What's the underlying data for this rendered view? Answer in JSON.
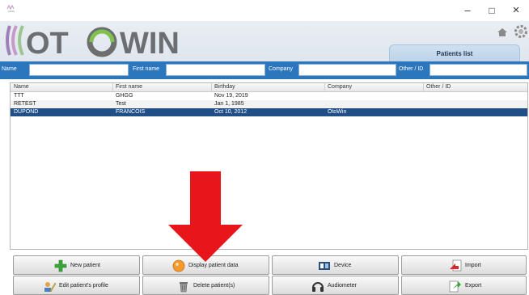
{
  "window": {
    "minimize": "–",
    "maximize": "□",
    "close": "×"
  },
  "header": {
    "logo_text": "OTOWIN",
    "tab_label": "Patients list"
  },
  "filters": [
    {
      "label": "Name",
      "value": ""
    },
    {
      "label": "First name",
      "value": ""
    },
    {
      "label": "Company",
      "value": ""
    },
    {
      "label": "Other / ID",
      "value": ""
    }
  ],
  "table": {
    "columns": [
      "Name",
      "First name",
      "Birthday",
      "Company",
      "Other / ID"
    ],
    "rows": [
      {
        "name": "TTT",
        "first_name": "GHGG",
        "birthday": "Nov 19, 2019",
        "company": "",
        "other": ""
      },
      {
        "name": "RETEST",
        "first_name": "Test",
        "birthday": "Jan 1, 1985",
        "company": "",
        "other": ""
      },
      {
        "name": "DUPOND",
        "first_name": "FRANCOIS",
        "birthday": "Oct 10, 2012",
        "company": "OtoWin",
        "other": ""
      }
    ],
    "selected_row": 2
  },
  "buttons": {
    "new_patient": "New patient",
    "display_patient_data": "Display patient data",
    "device": "Device",
    "import": "Import",
    "edit_profile": "Edit patient's profile",
    "delete_patients": "Delete patient(s)",
    "audiometer": "Audiometer",
    "export": "Export"
  },
  "colors": {
    "filter_bar": "#2c76bd",
    "selected_row": "#1f4f86",
    "annotation_arrow": "#e8161b"
  }
}
